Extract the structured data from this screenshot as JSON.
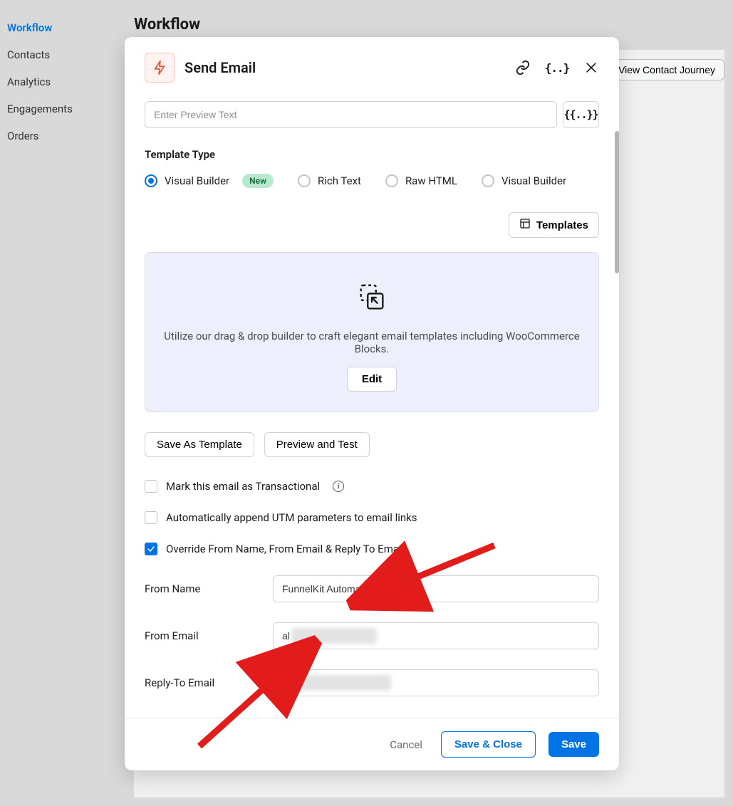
{
  "sidebar": {
    "items": [
      {
        "label": "Workflow",
        "active": true
      },
      {
        "label": "Contacts"
      },
      {
        "label": "Analytics"
      },
      {
        "label": "Engagements"
      },
      {
        "label": "Orders"
      }
    ]
  },
  "page": {
    "title": "Workflow",
    "view_journey": "View Contact Journey"
  },
  "modal": {
    "title": "Send Email",
    "preview_placeholder": "Enter Preview Text",
    "template_type_label": "Template Type",
    "template_options": [
      {
        "label": "Visual Builder",
        "badge": "New",
        "selected": true
      },
      {
        "label": "Rich Text",
        "selected": false
      },
      {
        "label": "Raw HTML",
        "selected": false
      },
      {
        "label": "Visual Builder",
        "selected": false
      }
    ],
    "templates_button": "Templates",
    "builder_desc": "Utilize our drag & drop builder to craft elegant email templates including WooCommerce Blocks.",
    "edit_button": "Edit",
    "save_as_template": "Save As Template",
    "preview_and_test": "Preview and Test",
    "checkboxes": {
      "transactional": {
        "label": "Mark this email as Transactional",
        "checked": false
      },
      "utm": {
        "label": "Automatically append UTM parameters to email links",
        "checked": false
      },
      "override": {
        "label": "Override From Name, From Email & Reply To Email",
        "checked": true
      }
    },
    "from_name": {
      "label": "From Name",
      "value": "FunnelKit Automations"
    },
    "from_email": {
      "label": "From Email",
      "value": "al"
    },
    "reply_to": {
      "label": "Reply-To Email",
      "value": "al"
    },
    "footer": {
      "cancel": "Cancel",
      "save_close": "Save & Close",
      "save": "Save"
    }
  }
}
